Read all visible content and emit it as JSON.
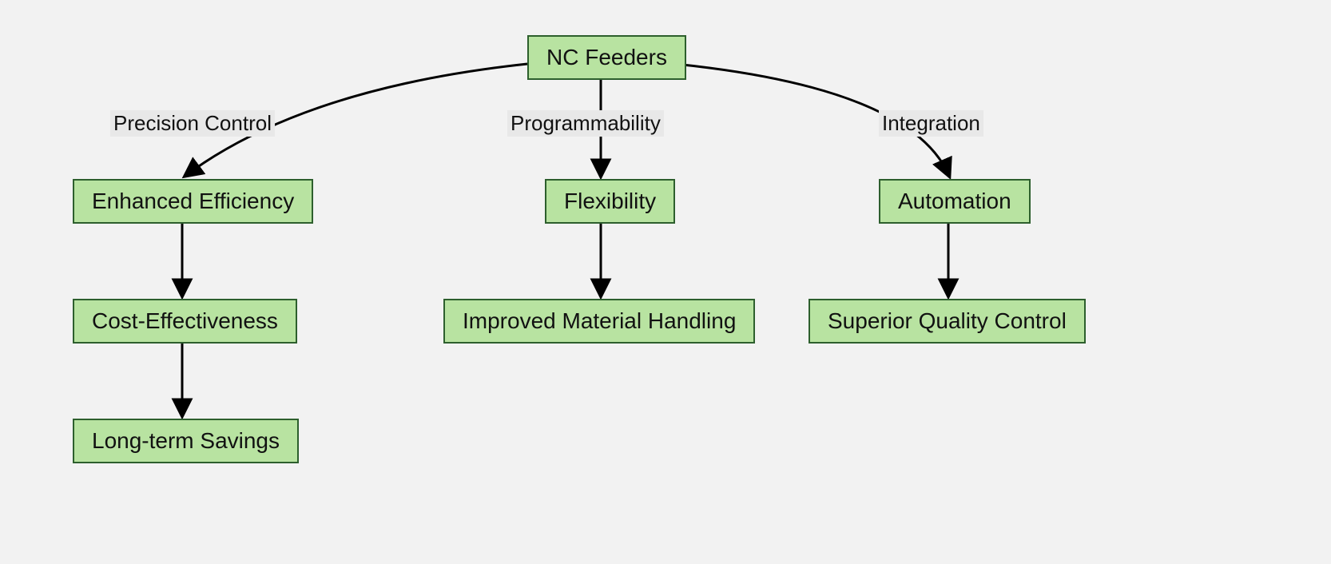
{
  "diagram": {
    "root": "NC Feeders",
    "edgeLabels": {
      "precision": "Precision Control",
      "programmability": "Programmability",
      "integration": "Integration"
    },
    "branches": {
      "left": {
        "n1": "Enhanced Efficiency",
        "n2": "Cost-Effectiveness",
        "n3": "Long-term Savings"
      },
      "center": {
        "n1": "Flexibility",
        "n2": "Improved Material Handling"
      },
      "right": {
        "n1": "Automation",
        "n2": "Superior Quality Control"
      }
    },
    "colors": {
      "nodeFill": "#b8e3a1",
      "nodeBorder": "#2d5f2d",
      "bg": "#f2f2f2"
    }
  }
}
